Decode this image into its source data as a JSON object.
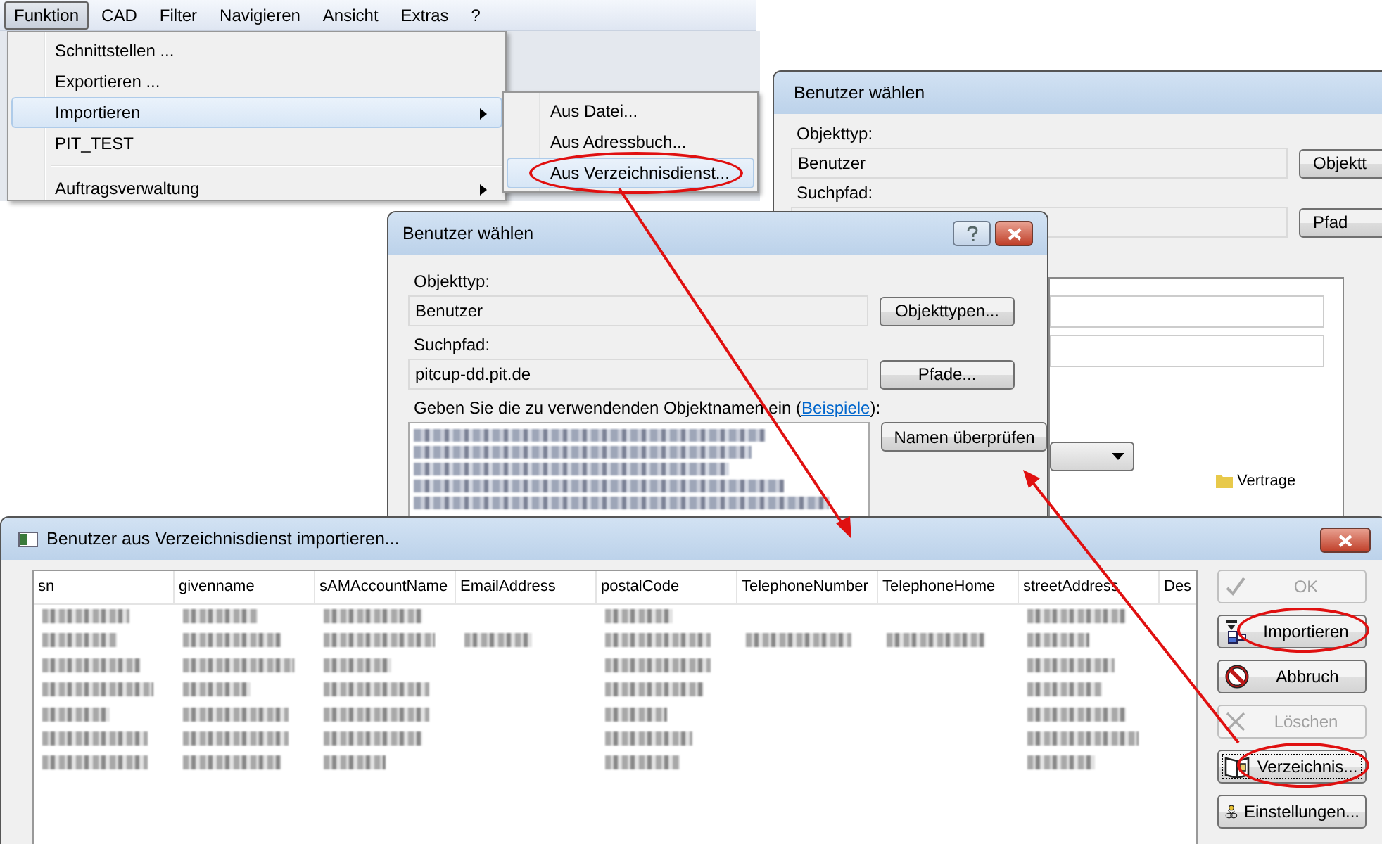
{
  "menubar": {
    "items": [
      {
        "label": "Funktion",
        "selected": true
      },
      {
        "label": "CAD",
        "selected": false
      },
      {
        "label": "Filter",
        "selected": false
      },
      {
        "label": "Navigieren",
        "selected": false
      },
      {
        "label": "Ansicht",
        "selected": false
      },
      {
        "label": "Extras",
        "selected": false
      },
      {
        "label": "?",
        "selected": false
      }
    ]
  },
  "menu": {
    "items": [
      {
        "kind": "item",
        "label": "Schnittstellen ...",
        "selected": false
      },
      {
        "kind": "item",
        "label": "Exportieren ...",
        "selected": false
      },
      {
        "kind": "submenu",
        "label": "Importieren",
        "selected": true
      },
      {
        "kind": "item",
        "label": "PIT_TEST",
        "selected": false
      },
      {
        "kind": "separator"
      },
      {
        "kind": "submenu",
        "label": "Auftragsverwaltung",
        "selected": false
      }
    ]
  },
  "submenu": {
    "items": [
      {
        "label": "Aus Datei...",
        "selected": false,
        "circled": false
      },
      {
        "label": "Aus Adressbuch...",
        "selected": false,
        "circled": false
      },
      {
        "label": "Aus Verzeichnisdienst...",
        "selected": true,
        "circled": true
      }
    ]
  },
  "back_dialog": {
    "title": "Benutzer wählen",
    "object_type_label": "Objekttyp:",
    "object_type_value": "Benutzer",
    "object_type_button": "Objektt",
    "search_path_label": "Suchpfad:",
    "search_path_button": "Pfad",
    "tree_item": "Vertrage"
  },
  "front_dialog": {
    "title": "Benutzer wählen",
    "object_type_label": "Objekttyp:",
    "object_type_value": "Benutzer",
    "object_types_button": "Objekttypen...",
    "search_path_label": "Suchpfad:",
    "search_path_value": "pitcup-dd.pit.de",
    "paths_button": "Pfade...",
    "names_prompt": "Geben Sie die zu verwendenden Objektnamen ein (",
    "examples_link": "Beispiele",
    "names_prompt_end": "):",
    "names_lines": [
      {
        "kind": "blurred"
      },
      {
        "kind": "blurred"
      },
      {
        "kind": "blurred"
      },
      {
        "kind": "blurred"
      },
      {
        "kind": "blurred"
      }
    ],
    "check_names_button": "Namen überprüfen"
  },
  "import_dialog": {
    "title": "Benutzer aus Verzeichnisdienst importieren...",
    "columns": [
      "sn",
      "givenname",
      "sAMAccountName",
      "EmailAddress",
      "postalCode",
      "TelephoneNumber",
      "TelephoneHome",
      "streetAddress",
      "Des"
    ],
    "rows": [
      {
        "blurred": [
          true,
          true,
          true,
          false,
          true,
          false,
          false,
          true,
          false
        ]
      },
      {
        "blurred": [
          true,
          true,
          true,
          true,
          true,
          true,
          true,
          true,
          false
        ]
      },
      {
        "blurred": [
          true,
          true,
          true,
          false,
          true,
          false,
          false,
          true,
          false
        ]
      },
      {
        "blurred": [
          true,
          true,
          true,
          false,
          true,
          false,
          false,
          true,
          false
        ]
      },
      {
        "blurred": [
          true,
          true,
          true,
          false,
          true,
          false,
          false,
          true,
          false
        ]
      },
      {
        "blurred": [
          true,
          true,
          true,
          false,
          true,
          false,
          false,
          true,
          false
        ]
      },
      {
        "blurred": [
          true,
          true,
          true,
          false,
          true,
          false,
          false,
          true,
          false
        ]
      }
    ],
    "buttons": [
      {
        "kind": "check",
        "label": "OK",
        "disabled": true,
        "focused": false,
        "circled": false
      },
      {
        "kind": "hierarchy",
        "label": "Importieren",
        "disabled": false,
        "focused": false,
        "circled": true
      },
      {
        "kind": "prohibited",
        "label": "Abbruch",
        "disabled": false,
        "focused": false,
        "circled": false
      },
      {
        "kind": "cross",
        "label": "Löschen",
        "disabled": true,
        "focused": false,
        "circled": false
      },
      {
        "kind": "book",
        "label": "Verzeichnis...",
        "disabled": false,
        "focused": true,
        "circled": true
      },
      {
        "kind": "person",
        "label": "Einstellungen...",
        "disabled": false,
        "focused": false,
        "circled": false
      }
    ]
  }
}
